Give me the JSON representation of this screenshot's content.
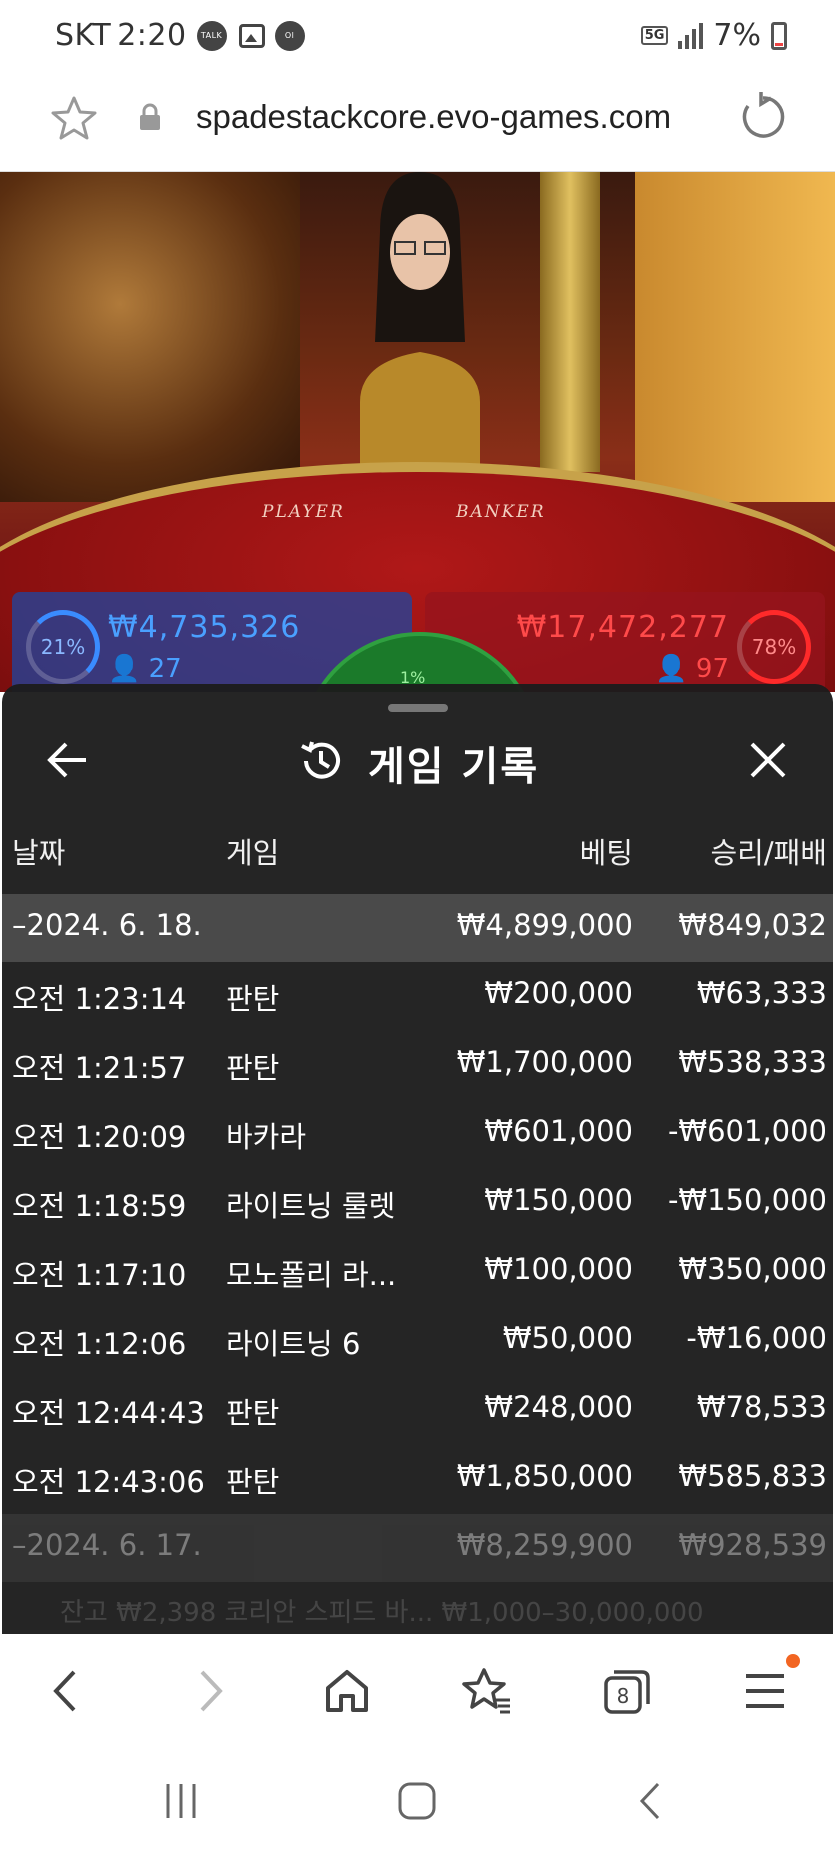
{
  "status_bar": {
    "carrier": "SKT",
    "time": "2:20",
    "notif_talk": "TALK",
    "notif_lock": "Ol LOCK",
    "network": "5G",
    "battery": "7%"
  },
  "url_bar": {
    "url": "spadestackcore.evo-games.com"
  },
  "video": {
    "player_label": "PLAYER",
    "banker_label": "BANKER",
    "player_pct": "21%",
    "player_amount": "₩4,735,326",
    "player_count": "27",
    "banker_pct": "78%",
    "banker_amount": "₩17,472,277",
    "banker_count": "97",
    "tie_pct": "1%"
  },
  "sheet": {
    "title": "게임 기록",
    "columns": {
      "date": "날짜",
      "game": "게임",
      "bet": "베팅",
      "win_loss": "승리/패배"
    },
    "rows": [
      {
        "kind": "group",
        "date": "–2024. 6. 18.",
        "game": "",
        "bet": "₩4,899,000",
        "win": "₩849,032"
      },
      {
        "kind": "item",
        "date": "오전 1:23:14",
        "game": "판탄",
        "bet": "₩200,000",
        "win": "₩63,333"
      },
      {
        "kind": "item",
        "date": "오전 1:21:57",
        "game": "판탄",
        "bet": "₩1,700,000",
        "win": "₩538,333"
      },
      {
        "kind": "item",
        "date": "오전 1:20:09",
        "game": "바카라",
        "bet": "₩601,000",
        "win": "-₩601,000"
      },
      {
        "kind": "item",
        "date": "오전 1:18:59",
        "game": "라이트닝 룰렛",
        "bet": "₩150,000",
        "win": "-₩150,000"
      },
      {
        "kind": "item",
        "date": "오전 1:17:10",
        "game": "모노폴리 라...",
        "bet": "₩100,000",
        "win": "₩350,000"
      },
      {
        "kind": "item",
        "date": "오전 1:12:06",
        "game": "라이트닝 6",
        "bet": "₩50,000",
        "win": "-₩16,000"
      },
      {
        "kind": "item",
        "date": "오전 12:44:43",
        "game": "판탄",
        "bet": "₩248,000",
        "win": "₩78,533"
      },
      {
        "kind": "item",
        "date": "오전 12:43:06",
        "game": "판탄",
        "bet": "₩1,850,000",
        "win": "₩585,833"
      },
      {
        "kind": "group-dim",
        "date": "–2024. 6. 17.",
        "game": "",
        "bet": "₩8,259,900",
        "win": "₩928,539"
      }
    ],
    "behind_text": "잔고 ₩2,398   코리안 스피드 바...  ₩1,000–30,000,000"
  },
  "browser_nav": {
    "tab_count": "8",
    "accent": "#f26522"
  }
}
